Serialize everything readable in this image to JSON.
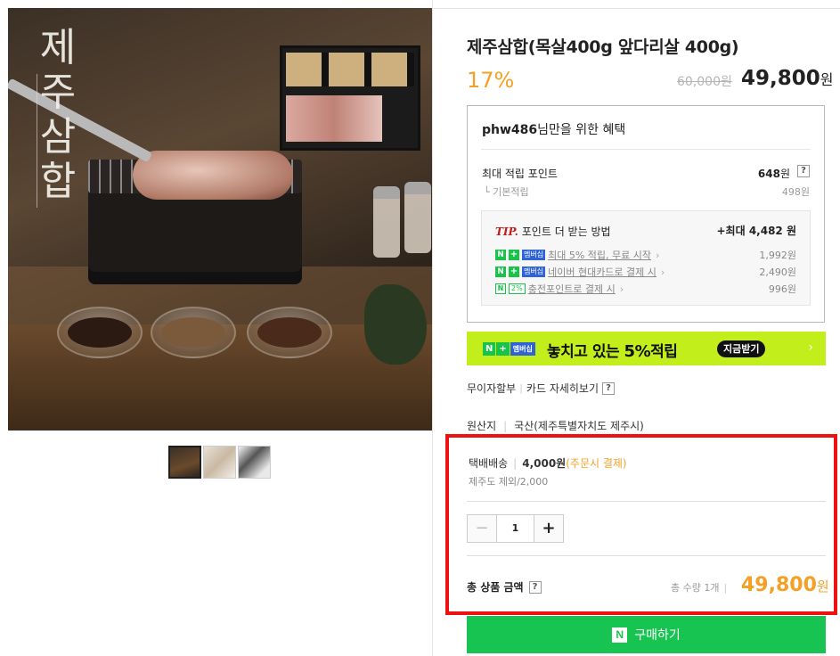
{
  "image": {
    "overlay_title": "제주삼합",
    "thumbnails": [
      "thumb-1",
      "thumb-2",
      "thumb-3"
    ]
  },
  "product": {
    "title": "제주삼합(목살400g 앞다리살 400g)",
    "discount": "17%",
    "original_price": "60,000원",
    "sale_price": "49,800",
    "sale_currency": "원"
  },
  "benefit": {
    "user": "phw486",
    "header_suffix": "님만을 위한 혜택",
    "max_points_label": "최대 적립 포인트",
    "max_points_value": "648",
    "max_points_unit": "원",
    "help": "?",
    "base_label": "기본적립",
    "base_value": "498원",
    "tip_prefix": "TIP.",
    "tip_label": "포인트 더 받는 방법",
    "tip_value": "+최대 4,482 원",
    "tips": [
      {
        "badge_n": "N",
        "badge_plus": "+",
        "badge_mem": "멤버십",
        "text": "최대 5% 적립, 무료 시작",
        "amount": "1,992원"
      },
      {
        "badge_n": "N",
        "badge_plus": "+",
        "badge_mem": "멤버십",
        "text": "네이버 현대카드로 결제 시",
        "amount": "2,490원"
      },
      {
        "badge_n": "N",
        "badge_pct": "2%",
        "text": "충전포인트로 결제 시",
        "amount": "996원"
      }
    ]
  },
  "promo": {
    "badge_n": "N",
    "badge_plus": "+",
    "badge_mem": "멤버십",
    "text_prefix": "놓치고 있는 ",
    "text_bold": "5%",
    "text_suffix": "적립",
    "cta": "지금받기",
    "chevron": "›"
  },
  "links": {
    "installment": "무이자할부",
    "card_detail": "카드 자세히보기",
    "help": "?"
  },
  "origin": {
    "label": "원산지",
    "value": "국산(제주특별자치도 제주시)"
  },
  "shipping": {
    "type": "택배배송",
    "fee": "4,000원",
    "pay_note": "(주문시 결제)",
    "jeju_note": "제주도 제외/2,000"
  },
  "quantity": {
    "minus": "−",
    "value": "1",
    "plus": "+"
  },
  "total": {
    "label": "총 상품 금액",
    "help": "?",
    "qty_label": "총 수량 1개",
    "price": "49,800",
    "currency": "원"
  },
  "buy": {
    "logo": "N",
    "label": "구매하기"
  },
  "colors": {
    "accent_orange": "#f4a024",
    "naver_green": "#18c451",
    "promo_lime": "#c2ee1c",
    "highlight_red": "#ee1111"
  }
}
